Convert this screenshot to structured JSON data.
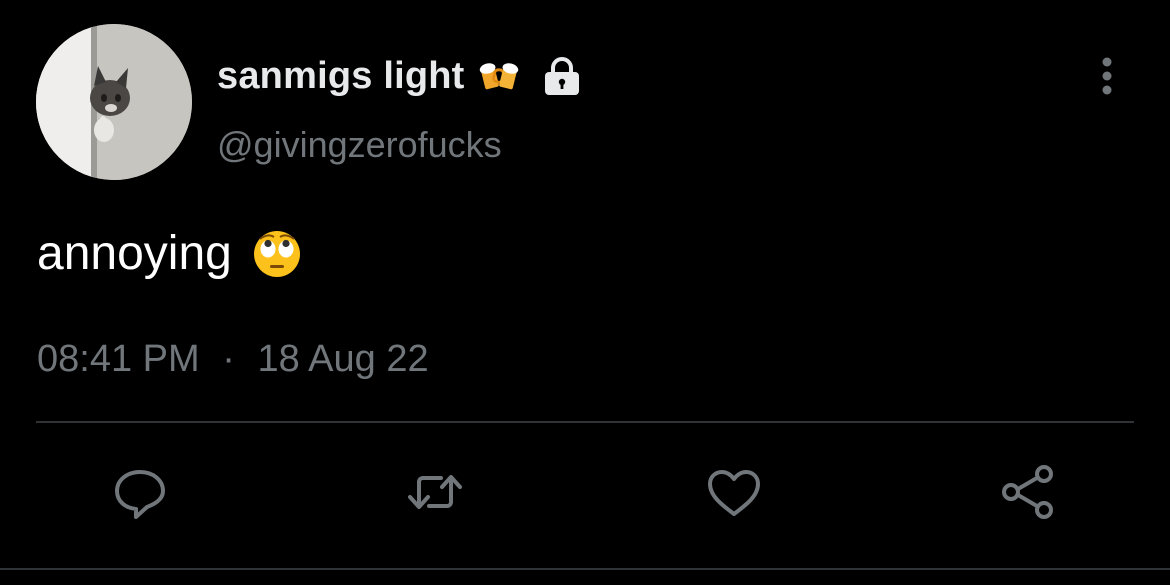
{
  "tweet": {
    "display_name": "sanmigs light",
    "name_emoji": "beer-mugs-icon",
    "protected_icon": "lock-icon",
    "handle": "@givingzerofucks",
    "text": "annoying",
    "text_emoji": "face-with-rolling-eyes-icon",
    "time": "08:41 PM",
    "separator": "·",
    "date": "18 Aug 22"
  },
  "actions": {
    "reply": "reply-icon",
    "retweet": "retweet-icon",
    "like": "heart-icon",
    "share": "share-icon",
    "more": "more-vertical-icon"
  },
  "colors": {
    "background": "#000000",
    "primary_text": "#e7e9ea",
    "secondary_text": "#71767b",
    "divider": "#2f3336"
  }
}
